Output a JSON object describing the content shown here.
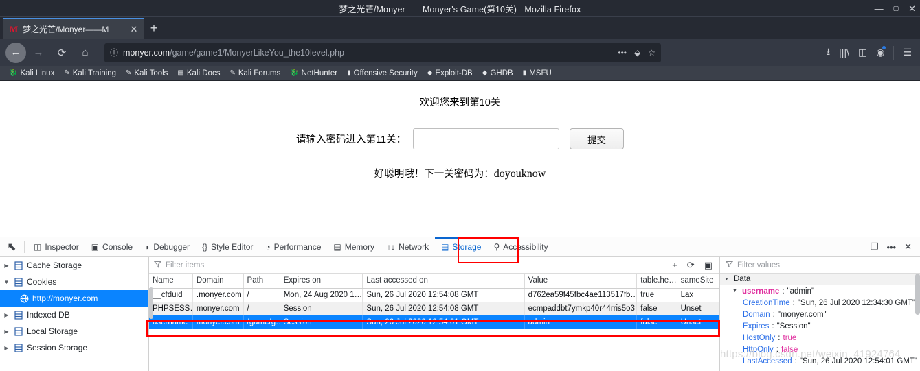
{
  "window": {
    "title": "梦之光芒/Monyer——Monyer's Game(第10关) - Mozilla Firefox",
    "minimize": "—",
    "maximize": "▢",
    "close": "✕"
  },
  "tabbar": {
    "tab_title": "梦之光芒/Monyer——M",
    "favicon": "M",
    "close_label": "✕",
    "newtab_label": "+"
  },
  "navbar": {
    "back": "←",
    "forward": "→",
    "reload": "⟳",
    "home": "⌂",
    "url_host": "monyer.com",
    "url_path": "/game/game1/MonyerLikeYou_the10level.php",
    "identity_icon": "ⓘ",
    "page_actions": "•••",
    "pocket": "⬙",
    "bookmark_star": "☆",
    "downloads": "⭳",
    "library": "|||\\",
    "sidebars": "◫",
    "account": "◉",
    "menu": "☰"
  },
  "bookmarks": [
    {
      "label": "Kali Linux",
      "icon": "🐉"
    },
    {
      "label": "Kali Training",
      "icon": "✎"
    },
    {
      "label": "Kali Tools",
      "icon": "✎"
    },
    {
      "label": "Kali Docs",
      "icon": "▤"
    },
    {
      "label": "Kali Forums",
      "icon": "✎"
    },
    {
      "label": "NetHunter",
      "icon": "🐉"
    },
    {
      "label": "Offensive Security",
      "icon": "▮"
    },
    {
      "label": "Exploit-DB",
      "icon": "◆"
    },
    {
      "label": "GHDB",
      "icon": "◆"
    },
    {
      "label": "MSFU",
      "icon": "▮"
    }
  ],
  "page": {
    "welcome": "欢迎您来到第10关",
    "prompt_label": "请输入密码进入第11关：",
    "password_value": "",
    "password_placeholder": "",
    "submit_label": "提交",
    "hint_prefix": "好聪明哦！下一关密码为：",
    "hint_password": "doyouknow"
  },
  "devtools": {
    "picker_icon": "⬉",
    "tabs": [
      {
        "label": "Inspector",
        "icon": "◫",
        "active": false
      },
      {
        "label": "Console",
        "icon": "▣",
        "active": false
      },
      {
        "label": "Debugger",
        "icon": "◗",
        "active": false
      },
      {
        "label": "Style Editor",
        "icon": "{}",
        "active": false
      },
      {
        "label": "Performance",
        "icon": "◔",
        "active": false
      },
      {
        "label": "Memory",
        "icon": "▤",
        "active": false
      },
      {
        "label": "Network",
        "icon": "↑↓",
        "active": false
      },
      {
        "label": "Storage",
        "icon": "▤",
        "active": true
      },
      {
        "label": "Accessibility",
        "icon": "⚲",
        "active": false
      }
    ],
    "toolbar_right": {
      "responsive": "❐",
      "more": "•••",
      "close": "✕"
    },
    "highlight_color": "#ff0000"
  },
  "storage_tree": [
    {
      "label": "Cache Storage",
      "twisty": "▶",
      "selected": false,
      "child": false
    },
    {
      "label": "Cookies",
      "twisty": "▼",
      "selected": false,
      "child": false
    },
    {
      "label": "http://monyer.com",
      "twisty": "",
      "selected": true,
      "child": true
    },
    {
      "label": "Indexed DB",
      "twisty": "▶",
      "selected": false,
      "child": false
    },
    {
      "label": "Local Storage",
      "twisty": "▶",
      "selected": false,
      "child": false
    },
    {
      "label": "Session Storage",
      "twisty": "▶",
      "selected": false,
      "child": false
    }
  ],
  "table_filter": {
    "placeholder": "Filter items",
    "add_icon": "+",
    "refresh_icon": "⟳",
    "columns_icon": "▣"
  },
  "cookies_table": {
    "columns": [
      "Name",
      "Domain",
      "Path",
      "Expires on",
      "Last accessed on",
      "Value",
      "table.he…",
      "sameSite"
    ],
    "rows": [
      {
        "name": "__cfduid",
        "domain": ".monyer.com",
        "path": "/",
        "expires": "Mon, 24 Aug 2020 1…",
        "last_accessed": "Sun, 26 Jul 2020 12:54:08 GMT",
        "value": "d762ea59f45fbc4ae113517fb…",
        "hostonly": "true",
        "samesite": "Lax",
        "selected": false,
        "alt": false
      },
      {
        "name": "PHPSESS…",
        "domain": "monyer.com",
        "path": "/",
        "expires": "Session",
        "last_accessed": "Sun, 26 Jul 2020 12:54:08 GMT",
        "value": "ecmpaddbt7ymkp40r44rris5o3",
        "hostonly": "false",
        "samesite": "Unset",
        "selected": false,
        "alt": true
      },
      {
        "name": "username",
        "domain": "monyer.com",
        "path": "/game/g…",
        "expires": "Session",
        "last_accessed": "Sun, 26 Jul 2020 12:54:01 GMT",
        "value": "admin",
        "hostonly": "false",
        "samesite": "Unset",
        "selected": true,
        "alt": false
      }
    ]
  },
  "values_panel": {
    "filter_placeholder": "Filter values",
    "root_label": "Data",
    "root_twisty": "▼",
    "item_twisty": "▼",
    "item_key": "username",
    "item_sep": ": ",
    "item_value": "\"admin\"",
    "props": [
      {
        "key": "CreationTime",
        "value": "\"Sun, 26 Jul 2020 12:34:30 GMT\"",
        "type": "str"
      },
      {
        "key": "Domain",
        "value": "\"monyer.com\"",
        "type": "str"
      },
      {
        "key": "Expires",
        "value": "\"Session\"",
        "type": "str"
      },
      {
        "key": "HostOnly",
        "value": "true",
        "type": "bool"
      },
      {
        "key": "HttpOnly",
        "value": "false",
        "type": "bool"
      },
      {
        "key": "LastAccessed",
        "value": "\"Sun, 26 Jul 2020 12:54:01 GMT\"",
        "type": "str"
      }
    ]
  },
  "watermark": "https://blog.csdn.net/weixin_41924764"
}
